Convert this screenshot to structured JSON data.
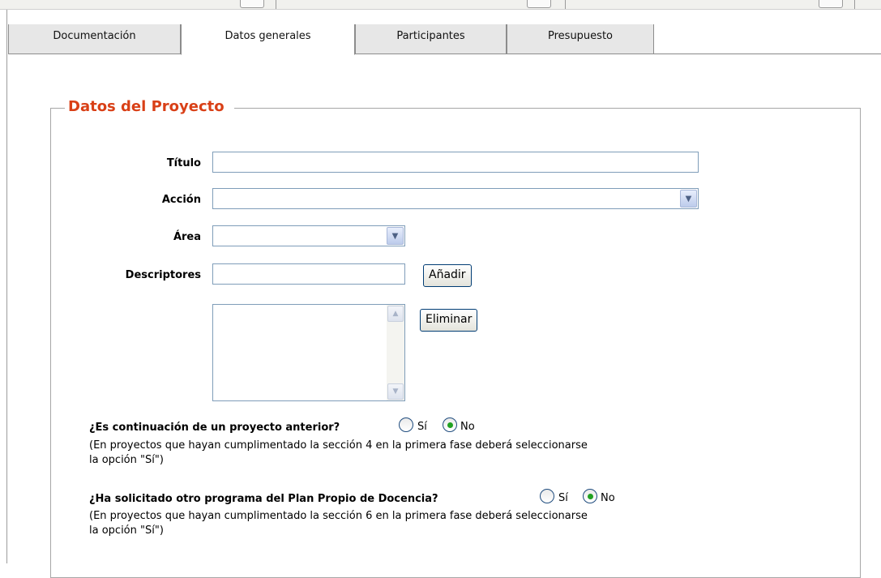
{
  "tabs": [
    {
      "label": "Documentación",
      "active": false
    },
    {
      "label": "Datos generales",
      "active": true
    },
    {
      "label": "Participantes",
      "active": false
    },
    {
      "label": "Presupuesto",
      "active": false
    }
  ],
  "section": {
    "legend": "Datos del Proyecto"
  },
  "form": {
    "titulo": {
      "label": "Título",
      "value": ""
    },
    "accion": {
      "label": "Acción",
      "value": ""
    },
    "area": {
      "label": "Área",
      "value": ""
    },
    "descriptores": {
      "label": "Descriptores",
      "value": "",
      "add_button": "Añadir",
      "remove_button": "Eliminar",
      "list_items": []
    }
  },
  "questions": [
    {
      "text": "¿Es continuación de un proyecto anterior?",
      "option_yes": "Sí",
      "option_no": "No",
      "selected": "No",
      "note_line1": "(En proyectos que hayan cumplimentado la sección 4 en la primera fase deberá seleccionarse",
      "note_line2": "la opción \"Sí\")"
    },
    {
      "text": "¿Ha solicitado otro programa del Plan Propio de Docencia?",
      "option_yes": "Sí",
      "option_no": "No",
      "selected": "No",
      "note_line1": "(En proyectos que hayan cumplimentado la sección 6 en la primera fase deberá seleccionarse",
      "note_line2": "la opción \"Sí\")"
    }
  ]
}
